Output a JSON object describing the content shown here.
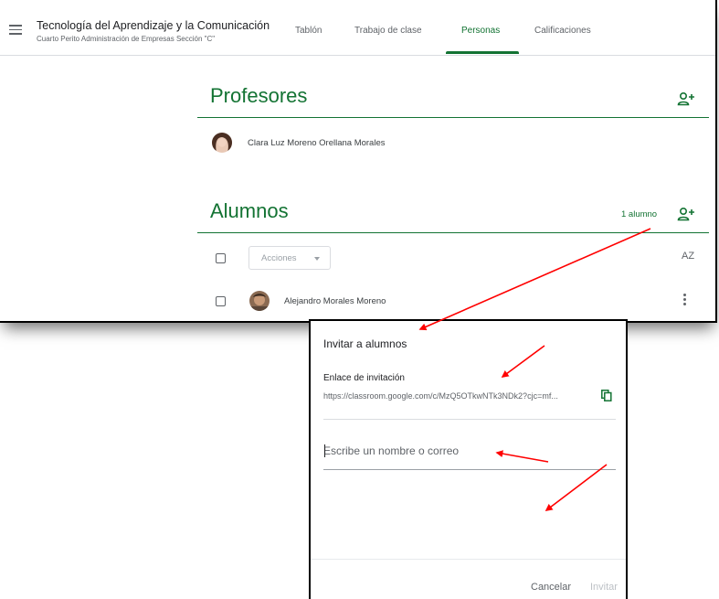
{
  "header": {
    "class_title": "Tecnología del Aprendizaje y la Comunicación",
    "class_subtitle": "Cuarto Perito Administración de Empresas Sección \"C\"",
    "tabs": [
      {
        "label": "Tablón",
        "active": false
      },
      {
        "label": "Trabajo de clase",
        "active": false
      },
      {
        "label": "Personas",
        "active": true
      },
      {
        "label": "Calificaciones",
        "active": false
      }
    ]
  },
  "teachers": {
    "title": "Profesores",
    "people": [
      {
        "name": "Clara Luz Moreno Orellana Morales"
      }
    ]
  },
  "students": {
    "title": "Alumnos",
    "count": "1 alumno",
    "actions_label": "Acciones",
    "sort_label": "AZ",
    "people": [
      {
        "name": "Alejandro Morales Moreno"
      }
    ]
  },
  "invite_dialog": {
    "title": "Invitar a alumnos",
    "link_label": "Enlace de invitación",
    "link_url": "https://classroom.google.com/c/MzQ5OTkwNTk3NDk2?cjc=mf...",
    "input_placeholder": "Escribe un nombre o correo",
    "cancel_label": "Cancelar",
    "invite_label": "Invitar"
  },
  "icons": {
    "menu": "hamburger-menu-icon",
    "add_person": "person-add-icon",
    "copy": "copy-icon",
    "sort": "sort-az-icon",
    "more": "more-vertical-icon"
  },
  "colors": {
    "accent": "#137333",
    "annotation_arrow": "#ff0000",
    "text": "#3c4043",
    "muted": "#5f6368"
  }
}
